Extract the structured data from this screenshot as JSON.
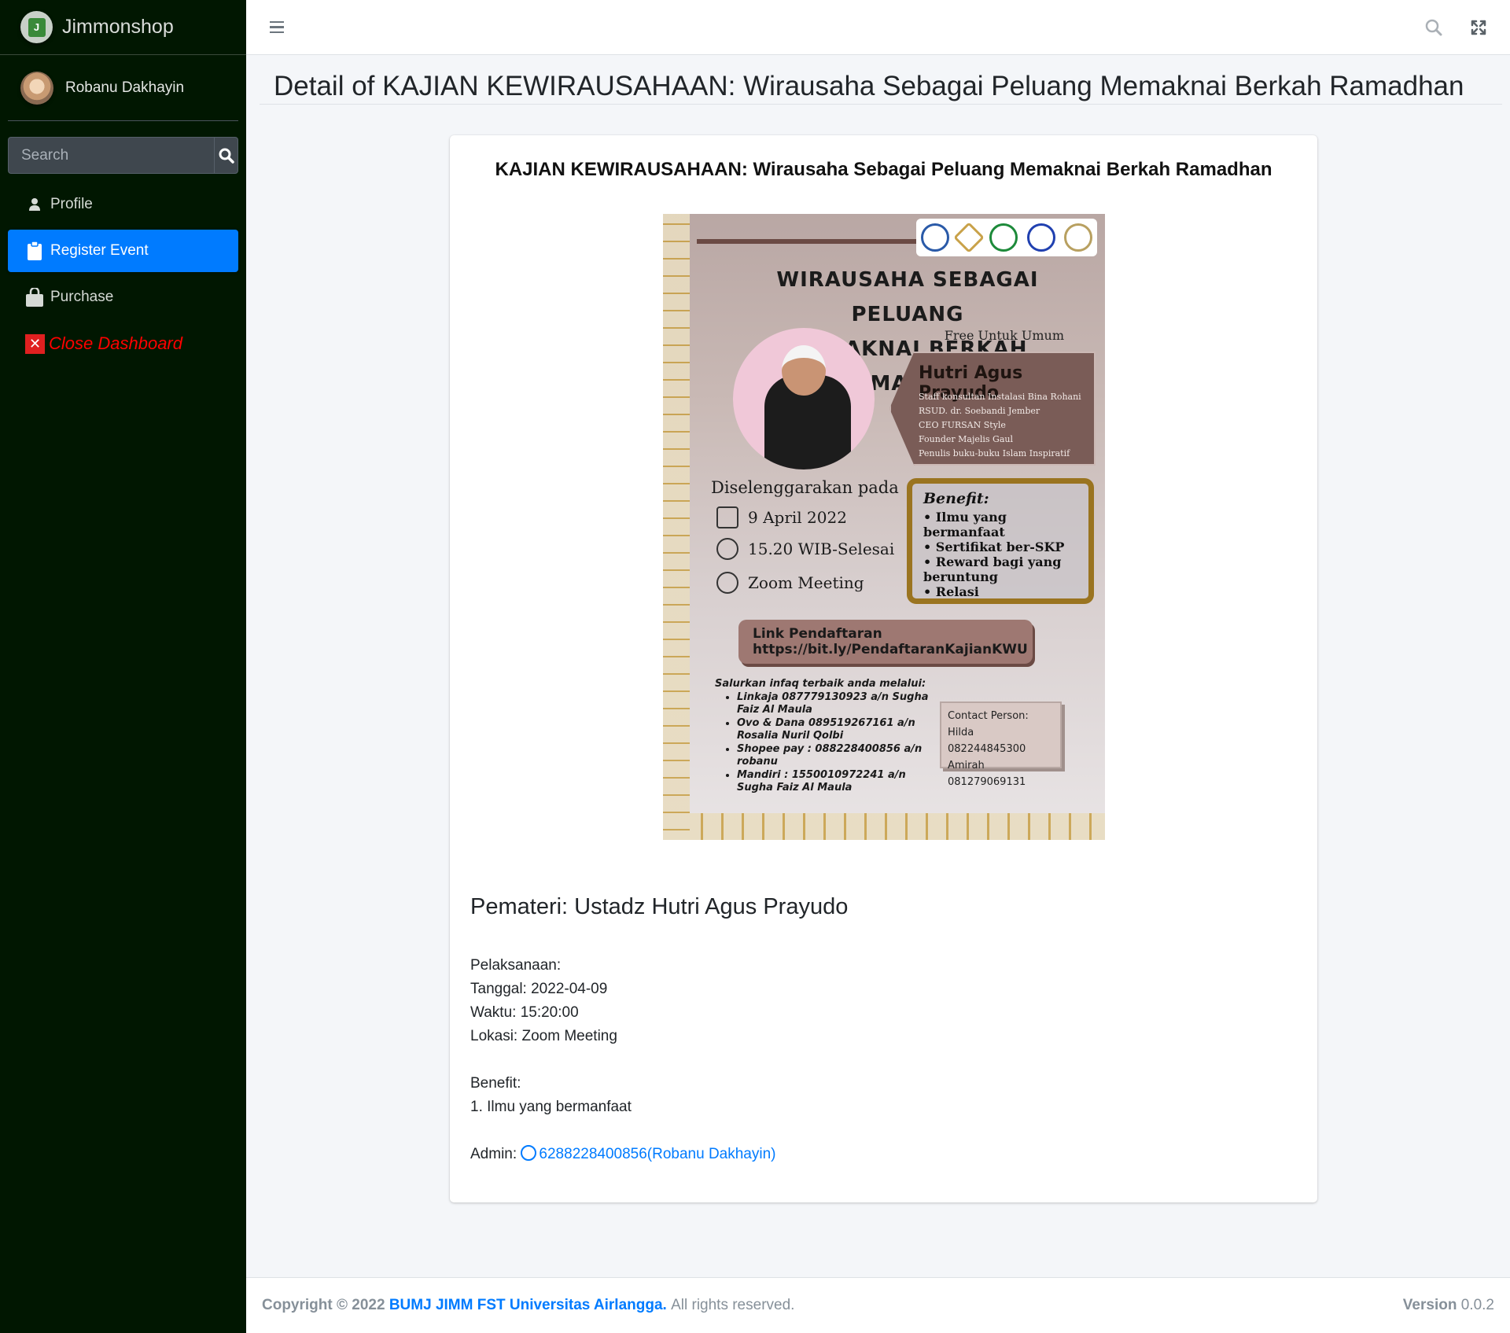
{
  "brand": {
    "name": "Jimmonshop",
    "logo_letter": "J"
  },
  "user": {
    "name": "Robanu Dakhayin"
  },
  "search": {
    "placeholder": "Search"
  },
  "nav": [
    {
      "label": "Profile",
      "icon": "user-icon"
    },
    {
      "label": "Register Event",
      "icon": "clipboard-icon",
      "active": true
    },
    {
      "label": "Purchase",
      "icon": "shopping-bag-icon"
    },
    {
      "label": "Close Dashboard",
      "icon": "close-square-icon"
    }
  ],
  "page": {
    "title": "Detail of KAJIAN KEWIRAUSAHAAN: Wirausaha Sebagai Peluang Memaknai Berkah Ramadhan"
  },
  "event": {
    "title": "KAJIAN KEWIRAUSAHAAN: Wirausaha Sebagai Peluang Memaknai Berkah Ramadhan",
    "poster": {
      "headline_1": "WIRAUSAHA SEBAGAI PELUANG",
      "headline_2": "MEMAKNAI BERKAH RAMADHAN",
      "free": "Free Untuk Umum",
      "speaker": "Hutri Agus Prayudo",
      "speaker_roles": [
        "Staff konsultan Instalasi Bina Rohani RSUD. dr. Soebandi Jember",
        "CEO FURSAN Style",
        "Founder Majelis Gaul",
        "Penulis buku-buku Islam Inspiratif"
      ],
      "held_label": "Diselenggarakan pada",
      "date": "9 April 2022",
      "time": "15.20 WIB-Selesai",
      "place": "Zoom Meeting",
      "benefit_title": "Benefit:",
      "benefits": [
        "Ilmu yang bermanfaat",
        "Sertifikat ber-SKP",
        "Reward bagi yang beruntung",
        "Relasi"
      ],
      "link_label": "Link Pendaftaran",
      "link_url": "https://bit.ly/PendaftaranKajianKWU",
      "infaq_title": "Salurkan infaq terbaik anda melalui:",
      "infaq": [
        "Linkaja 087779130923 a/n Sugha Faiz Al Maula",
        "Ovo & Dana 089519267161 a/n Rosalia Nuril Qolbi",
        "Shopee pay : 088228400856 a/n robanu",
        "Mandiri : 1550010972241 a/n Sugha Faiz Al Maula"
      ],
      "contact_title": "Contact Person:",
      "contacts": [
        "Hilda 082244845300",
        "Amirah 081279069131"
      ]
    },
    "pemateri": "Pemateri: Ustadz Hutri Agus Prayudo",
    "pelaksanaan_label": "Pelaksanaan:",
    "tanggal": "Tanggal: 2022-04-09",
    "waktu": "Waktu: 15:20:00",
    "lokasi": "Lokasi: Zoom Meeting",
    "benefit_label": "Benefit:",
    "benefit_1": "1. Ilmu yang bermanfaat",
    "admin_label": "Admin:",
    "admin_link": "6288228400856(Robanu Dakhayin)"
  },
  "footer": {
    "copyright": "Copyright © 2022",
    "org": "BUMJ JIMM FST Universitas Airlangga.",
    "rights": "All rights reserved.",
    "version_label": "Version",
    "version": "0.0.2"
  },
  "colors": {
    "sidebar": "#011701",
    "accent": "#007bff",
    "close": "#ff0000"
  }
}
